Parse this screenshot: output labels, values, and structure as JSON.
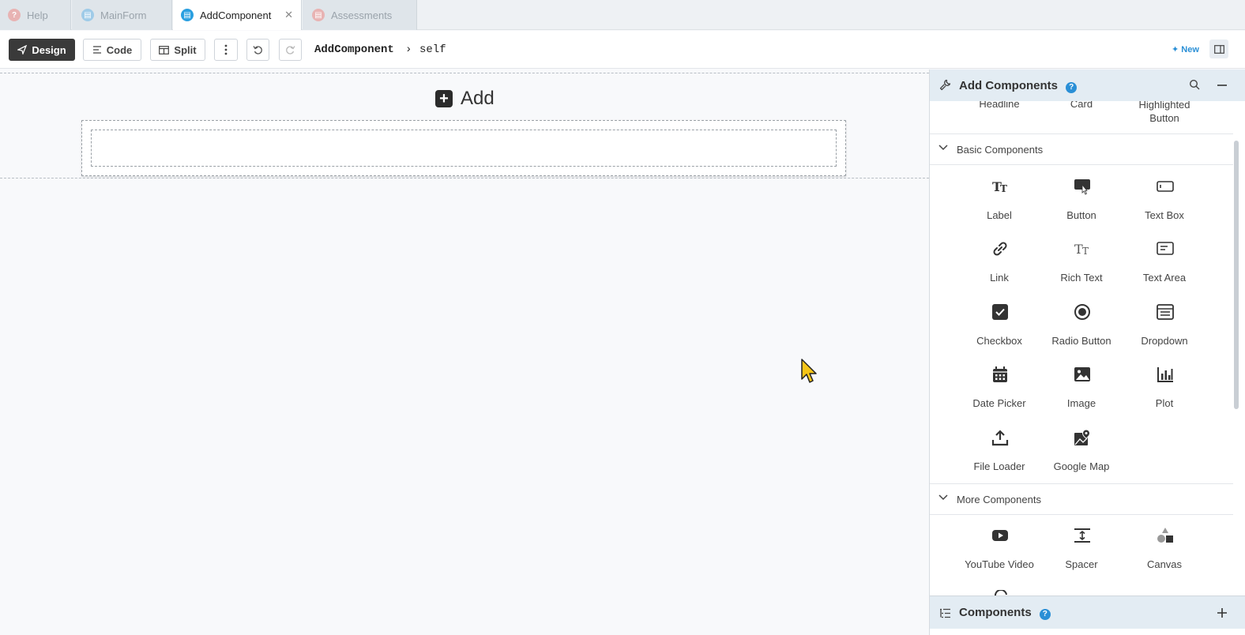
{
  "tabs": [
    {
      "label": "Help",
      "color": "#e8a0a0",
      "glyph": "?"
    },
    {
      "label": "MainForm",
      "color": "#8fc3e6",
      "glyph": "▤"
    },
    {
      "label": "AddComponent",
      "color": "#2a9fe0",
      "glyph": "▤",
      "active": true
    },
    {
      "label": "Assessments",
      "color": "#e8a0a0",
      "glyph": "▤"
    }
  ],
  "toolbar": {
    "design_label": "Design",
    "code_label": "Code",
    "split_label": "Split",
    "crumb_main": "AddComponent",
    "crumb_sep": "›",
    "crumb_sub": "self",
    "new_label": "New"
  },
  "canvas": {
    "add_title": "Add"
  },
  "panel": {
    "title": "Add Components",
    "help": "?",
    "top_row": [
      "Headline",
      "Card",
      "Highlighted Button"
    ],
    "sections": [
      {
        "label": "Basic Components",
        "items": [
          "Label",
          "Button",
          "Text Box",
          "Link",
          "Rich Text",
          "Text Area",
          "Checkbox",
          "Radio Button",
          "Dropdown",
          "Date Picker",
          "Image",
          "Plot",
          "File Loader",
          "Google Map"
        ]
      },
      {
        "label": "More Components",
        "items": [
          "YouTube Video",
          "Spacer",
          "Canvas"
        ]
      }
    ],
    "footer_title": "Components"
  },
  "colors": {
    "accent": "#2a8fd6",
    "dark_button": "#3a3a3a",
    "panel_header": "#e3ecf3",
    "cursor": "#f5c518"
  }
}
